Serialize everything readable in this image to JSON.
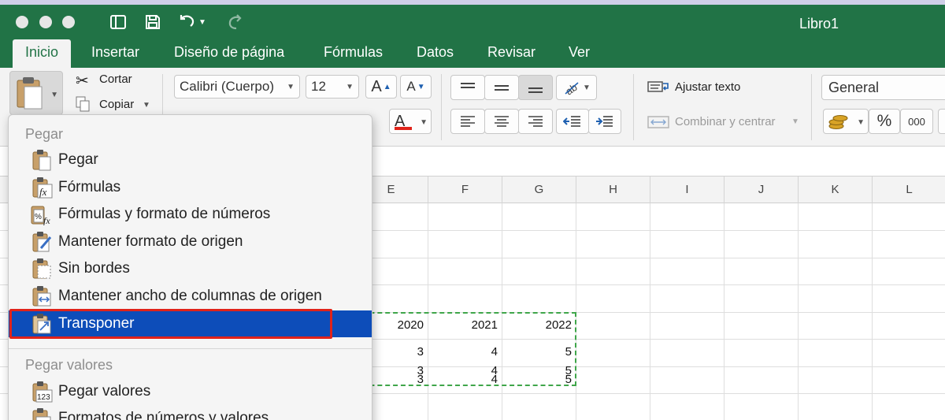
{
  "window": {
    "title": "Libro1"
  },
  "tabs": [
    {
      "label": "Inicio",
      "active": true
    },
    {
      "label": "Insertar"
    },
    {
      "label": "Diseño de página"
    },
    {
      "label": "Fórmulas"
    },
    {
      "label": "Datos"
    },
    {
      "label": "Revisar"
    },
    {
      "label": "Ver"
    }
  ],
  "ribbon": {
    "cut_label": "Cortar",
    "copy_label": "Copiar",
    "font_name": "Calibri (Cuerpo)",
    "font_size": "12",
    "grow_font": "A",
    "shrink_font": "A",
    "font_color_glyph": "A",
    "wrap_text_label": "Ajustar texto",
    "merge_center_label": "Combinar y centrar",
    "number_format": "General",
    "percent": "%",
    "thousands": "000",
    "accent_color": "#217346",
    "font_color_swatch": "#e0231a"
  },
  "columns": [
    "E",
    "F",
    "G",
    "H",
    "I",
    "J",
    "K",
    "L"
  ],
  "cells": {
    "years": [
      "2020",
      "2021",
      "2022"
    ],
    "rows": [
      [
        "3",
        "4",
        "5"
      ],
      [
        "3",
        "4",
        "5"
      ],
      [
        "3",
        "4",
        "5"
      ]
    ]
  },
  "menu": {
    "section1": "Pegar",
    "items": [
      {
        "label": "Pegar",
        "icon": "clipboard-icon"
      },
      {
        "label": "Fórmulas",
        "icon": "fx-icon"
      },
      {
        "label": "Fórmulas y formato de números",
        "icon": "percent-fx-icon"
      },
      {
        "label": "Mantener formato de origen",
        "icon": "brush-clipboard-icon"
      },
      {
        "label": "Sin bordes",
        "icon": "no-borders-icon"
      },
      {
        "label": "Mantener ancho de columnas de origen",
        "icon": "column-width-icon"
      },
      {
        "label": "Transponer",
        "icon": "transpose-icon",
        "selected": true
      }
    ],
    "section2": "Pegar valores",
    "items2": [
      {
        "label": "Pegar valores",
        "icon": "values-123-icon"
      },
      {
        "label": "Formatos de números y valores",
        "icon": "percent-values-icon"
      }
    ],
    "selection_color": "#0d4db9",
    "highlight_color": "#e0231a"
  }
}
